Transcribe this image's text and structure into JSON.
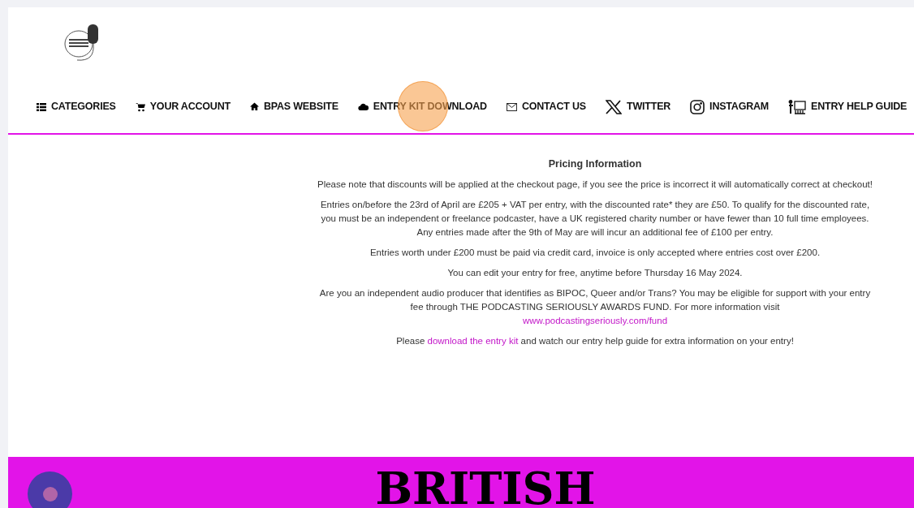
{
  "nav": [
    {
      "label": "CATEGORIES",
      "kind": "list"
    },
    {
      "label": "YOUR ACCOUNT",
      "kind": "cart"
    },
    {
      "label": "BPAS WEBSITE",
      "kind": "home"
    },
    {
      "label": "ENTRY KIT DOWNLOAD",
      "kind": "cloud"
    },
    {
      "label": "CONTACT US",
      "kind": "mail"
    },
    {
      "label": "TWITTER",
      "kind": "x"
    },
    {
      "label": "INSTAGRAM",
      "kind": "instagram"
    },
    {
      "label": "ENTRY HELP GUIDE",
      "kind": "presenter"
    }
  ],
  "content": {
    "title": "Pricing Information",
    "paragraphs": [
      {
        "parts": [
          {
            "text": "Please note that discounts will be applied at the checkout page, if you see the price is incorrect it will automatically correct at checkout!"
          }
        ]
      },
      {
        "parts": [
          {
            "text": "Entries on/before the 23rd of April are £205 + VAT per entry, with the discounted rate* they are £50. To qualify for the discounted rate, you must be an independent or freelance podcaster, have a UK registered charity number or have fewer than 10 full time employees. Any entries made after the 9th of May are will incur an additional fee of £100 per entry."
          }
        ]
      },
      {
        "parts": [
          {
            "text": "Entries worth under £200 must be paid via credit card, invoice is only accepted where entries cost over £200."
          }
        ]
      },
      {
        "parts": [
          {
            "text": "You can edit your entry for free, anytime before Thursday 16 May 2024."
          }
        ]
      },
      {
        "parts": [
          {
            "text": "Are you an independent audio producer that identifies as BIPOC, Queer and/or Trans? You may be eligible for support with your entry fee through THE PODCASTING SERIOUSLY AWARDS FUND. For more information visit"
          },
          {
            "kind": "block_link",
            "text": "www.podcastingseriously.com/fund"
          }
        ]
      },
      {
        "parts": [
          {
            "text": "Please "
          },
          {
            "kind": "link",
            "text": "download the entry kit"
          },
          {
            "text": " and watch our entry help guide for extra information on your entry!"
          }
        ]
      }
    ]
  },
  "banner": {
    "heading": "BRITISH"
  }
}
